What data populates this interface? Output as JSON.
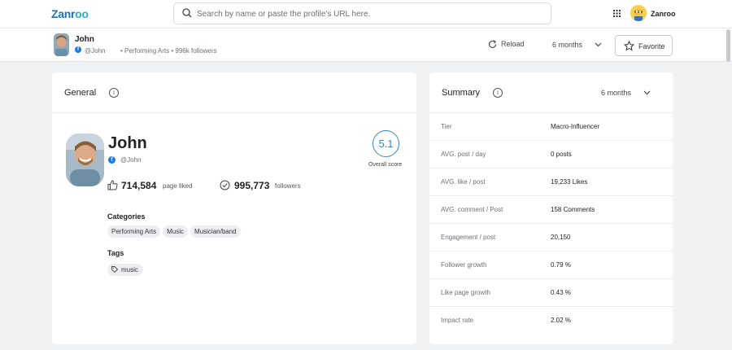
{
  "app": {
    "logo_main": "Zanr",
    "logo_accent": "oo"
  },
  "search": {
    "placeholder": "Search by name or paste the profile's URL here."
  },
  "user": {
    "name": "Zanroo"
  },
  "profile_bar": {
    "name": "John",
    "handle": "@John",
    "meta": "• Performing Arts • 996k followers",
    "reload_label": "Reload",
    "period": "6 months",
    "favorite_label": "Favorite"
  },
  "general": {
    "title": "General",
    "name": "John",
    "handle": "@John",
    "page_liked_value": "714,584",
    "page_liked_label": "page liked",
    "followers_value": "995,773",
    "followers_label": "followers",
    "score": "5.1",
    "score_label": "Overall score",
    "categories_title": "Categories",
    "categories": [
      "Performing Arts",
      "Music",
      "Musician/band"
    ],
    "tags_title": "Tags",
    "tags": [
      "music"
    ]
  },
  "summary": {
    "title": "Summary",
    "period": "6 months",
    "rows": [
      {
        "key": "Tier",
        "value": "Macro-Influencer"
      },
      {
        "key": "AVG. post / day",
        "value": "0 posts"
      },
      {
        "key": "AVG. like / post",
        "value": "19,233 Likes"
      },
      {
        "key": "AVG. comment / Post",
        "value": "158 Comments"
      },
      {
        "key": "Engagement / post",
        "value": "20,150"
      },
      {
        "key": "Follower growth",
        "value": "0.79 %"
      },
      {
        "key": "Like page growth",
        "value": "0.43 %"
      },
      {
        "key": "Impact rate",
        "value": "2.02 %"
      }
    ]
  },
  "colors": {
    "accent": "#1f6fb2",
    "facebook": "#1877f2",
    "score": "#3b82c4"
  }
}
